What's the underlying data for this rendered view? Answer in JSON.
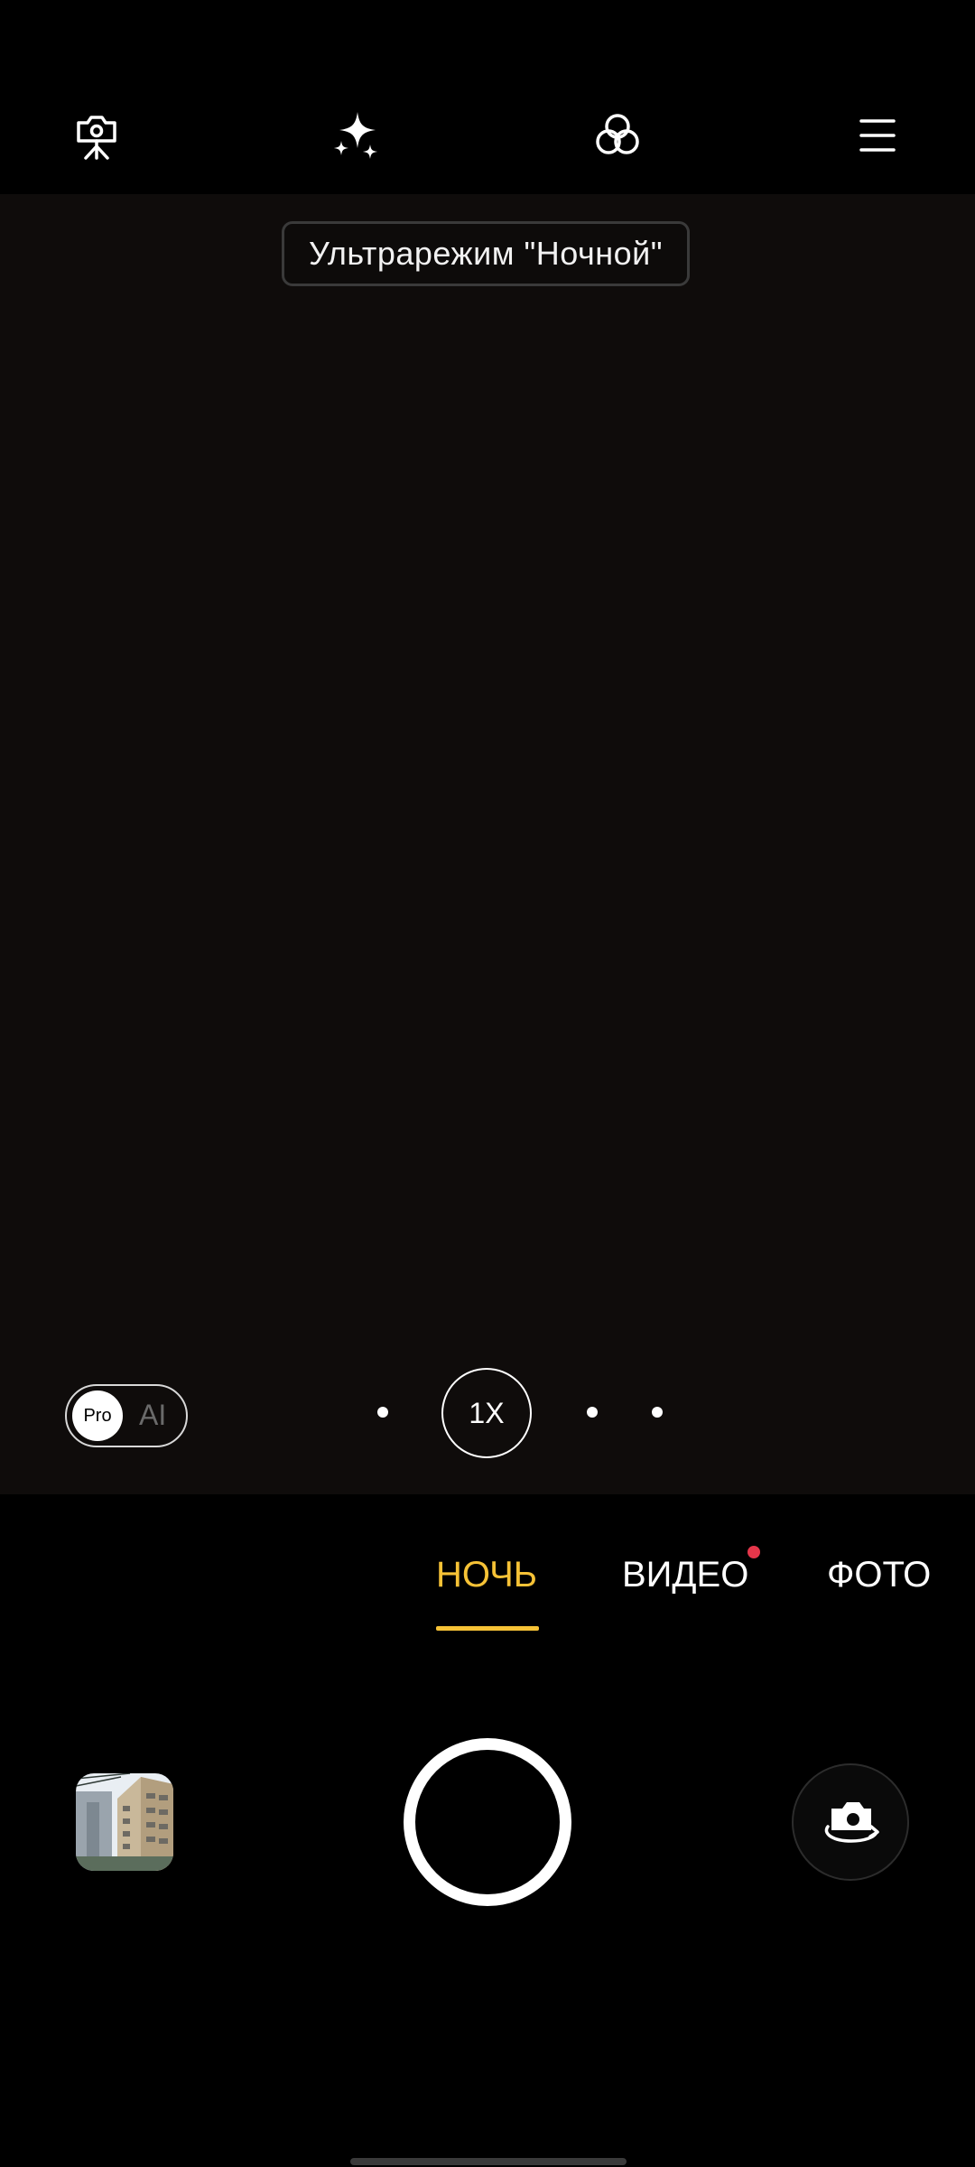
{
  "top_bar": {
    "icons": [
      "tripod-camera-icon",
      "sparkles-icon",
      "filters-icon",
      "menu-icon"
    ]
  },
  "banner": {
    "text": "Ультрарежим \"Ночной\""
  },
  "pro_ai": {
    "pro_label": "Pro",
    "ai_label": "AI"
  },
  "zoom": {
    "current_label": "1X"
  },
  "modes": {
    "active": "НОЧЬ",
    "items": [
      "НОЧЬ",
      "ВИДЕО",
      "ФОТО"
    ]
  },
  "colors": {
    "accent": "#f6c236",
    "badge": "#e5364a",
    "viewfinder": "#0f0c0b"
  }
}
